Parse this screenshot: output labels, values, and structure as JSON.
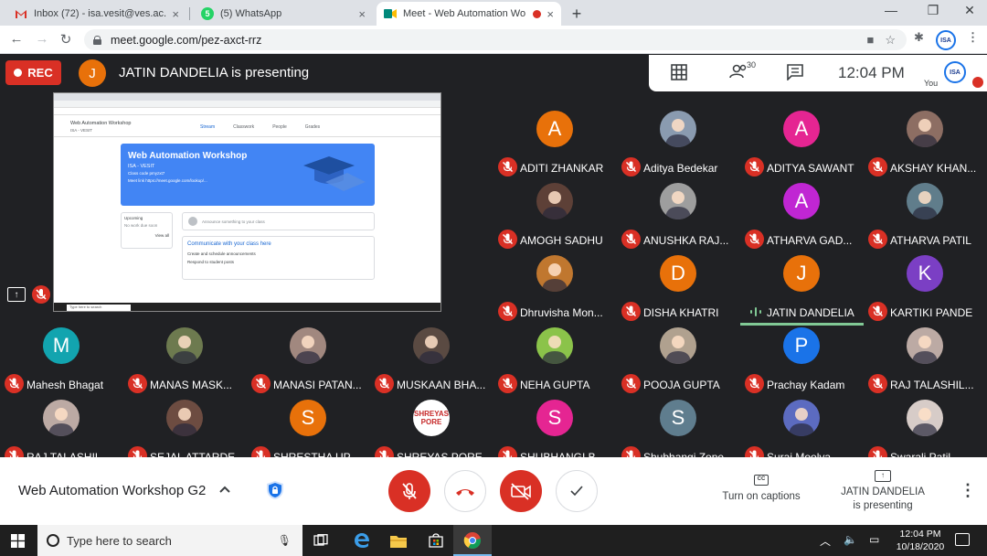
{
  "browser": {
    "tabs": [
      {
        "title": "Inbox (72) - isa.vesit@ves.ac.in - V",
        "icon": "gmail-icon"
      },
      {
        "title": "(5) WhatsApp",
        "icon": "whatsapp-icon"
      },
      {
        "title": "Meet - Web Automation Wo",
        "icon": "meet-icon",
        "active": true
      }
    ],
    "url": "meet.google.com/pez-axct-rrz"
  },
  "meet": {
    "rec_label": "REC",
    "presenter_initial": "J",
    "presenter_text": "JATIN DANDELIA is presenting",
    "participant_count": "30",
    "time": "12:04 PM",
    "you_label": "You",
    "self_avatar": "ISA",
    "presentation_name": "JATIN DANDELIA",
    "slide": {
      "class_title": "Web Automation Workshop",
      "class_sub": "ISA - VESIT",
      "tabs": [
        "Stream",
        "Classwork",
        "People",
        "Grades"
      ],
      "banner_title": "Web Automation Workshop",
      "banner_sub": "ISA - VESIT",
      "class_code": "Class code  pmyzxt7",
      "meet_link": "Meet link  https://meet.google.com/lookup/...",
      "upcoming": "Upcoming",
      "upcoming_sub": "No work due soon",
      "view_all": "View all",
      "announce": "Announce something to your class",
      "comm_title": "Communicate with your class here",
      "comm_1": "Create and schedule announcements",
      "comm_2": "Respond to student posts",
      "taskbar_search": "Type here to search"
    },
    "participants": [
      {
        "name": "ADITI ZHANKAR",
        "initial": "A",
        "color": "#e8710a",
        "photo": false
      },
      {
        "name": "Aditya Bedekar",
        "initial": "",
        "color": "#8a9bb0",
        "photo": true
      },
      {
        "name": "ADITYA SAWANT",
        "initial": "A",
        "color": "#e52592",
        "photo": false
      },
      {
        "name": "AKSHAY KHAN...",
        "initial": "",
        "color": "#8d6e63",
        "photo": true
      },
      {
        "name": "AMOGH SADHU",
        "initial": "",
        "color": "#5d4037",
        "photo": true
      },
      {
        "name": "ANUSHKA RAJ...",
        "initial": "",
        "color": "#9e9e9e",
        "photo": true
      },
      {
        "name": "ATHARVA GAD...",
        "initial": "A",
        "color": "#c026d3",
        "photo": false
      },
      {
        "name": "ATHARVA PATIL",
        "initial": "",
        "color": "#607d8b",
        "photo": true
      },
      {
        "name": "Dhruvisha Mon...",
        "initial": "",
        "color": "#c0772f",
        "photo": true
      },
      {
        "name": "DISHA KHATRI",
        "initial": "D",
        "color": "#e8710a",
        "photo": false
      },
      {
        "name": "JATIN DANDELIA",
        "initial": "J",
        "color": "#e8710a",
        "photo": false
      },
      {
        "name": "KARTIKI PANDE",
        "initial": "K",
        "color": "#7b3fc4",
        "photo": false
      },
      {
        "name": "Mahesh Bhagat",
        "initial": "M",
        "color": "#12a4af",
        "photo": false
      },
      {
        "name": "MANAS MASK...",
        "initial": "",
        "color": "#6d7a4f",
        "photo": true
      },
      {
        "name": "MANASI PATAN...",
        "initial": "",
        "color": "#a1887f",
        "photo": true
      },
      {
        "name": "MUSKAAN BHA...",
        "initial": "",
        "color": "#5a4a42",
        "photo": true
      },
      {
        "name": "NEHA GUPTA",
        "initial": "",
        "color": "#8bc34a",
        "photo": true
      },
      {
        "name": "POOJA GUPTA",
        "initial": "",
        "color": "#b0a18f",
        "photo": true
      },
      {
        "name": "Prachay Kadam",
        "initial": "P",
        "color": "#1a73e8",
        "photo": false
      },
      {
        "name": "RAJ TALASHIL...",
        "initial": "",
        "color": "#bcaaa4",
        "photo": true
      },
      {
        "name": "RAJ TALASHIL...",
        "initial": "",
        "color": "#bcaaa4",
        "photo": true
      },
      {
        "name": "SEJAL ATTARDE",
        "initial": "",
        "color": "#6d4c41",
        "photo": true
      },
      {
        "name": "SHRESTHA UP...",
        "initial": "S",
        "color": "#e8710a",
        "photo": false
      },
      {
        "name": "SHREYAS PORE",
        "initial": "SHREYAS PORE",
        "color": "#ffffff",
        "photo": false,
        "textlogo": true
      },
      {
        "name": "SHUBHANGI B",
        "initial": "S",
        "color": "#e52592",
        "photo": false
      },
      {
        "name": "Shubhangi Zope",
        "initial": "S",
        "color": "#5f7d8e",
        "photo": false
      },
      {
        "name": "Suraj Moolya",
        "initial": "",
        "color": "#5c6bc0",
        "photo": true
      },
      {
        "name": "Swarali Patil",
        "initial": "",
        "color": "#d7ccc8",
        "photo": true
      }
    ],
    "speaking_index": 10
  },
  "controls": {
    "meeting_title": "Web Automation Workshop G2",
    "captions_label": "Turn on captions",
    "captions_icon": "CC",
    "presenting_line1": "JATIN DANDELIA",
    "presenting_line2": "is presenting"
  },
  "taskbar": {
    "search_placeholder": "Type here to search",
    "time": "12:04 PM",
    "date": "10/18/2020"
  }
}
